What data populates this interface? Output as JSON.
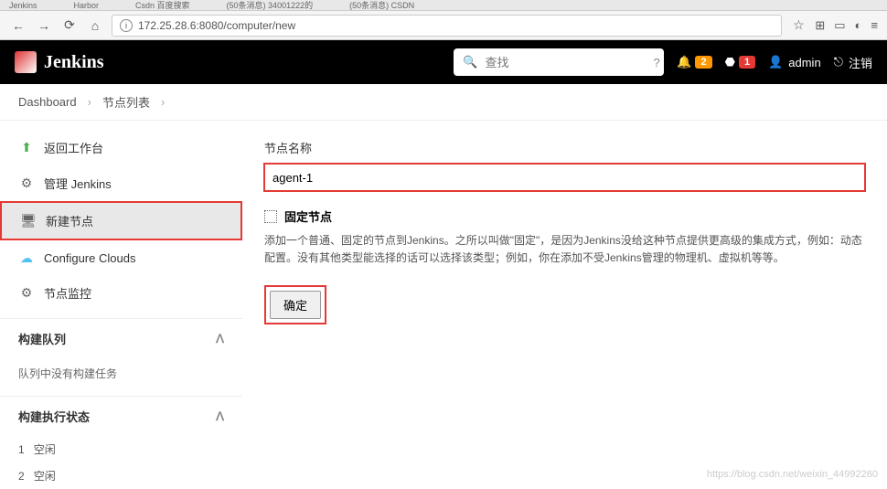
{
  "browser": {
    "tabs": [
      "Jenkins",
      "Harbor",
      "Csdn 百度搜索",
      "(50条消息) 34001222的",
      "(50条消息) CSDN"
    ],
    "url": "172.25.28.6:8080/computer/new"
  },
  "header": {
    "title": "Jenkins",
    "search_placeholder": "查找",
    "notif_count": "2",
    "alert_count": "1",
    "username": "admin",
    "logout_label": "注销"
  },
  "breadcrumbs": {
    "items": [
      "Dashboard",
      "节点列表"
    ]
  },
  "sidebar": {
    "links": [
      {
        "label": "返回工作台"
      },
      {
        "label": "管理 Jenkins"
      },
      {
        "label": "新建节点"
      },
      {
        "label": "Configure Clouds"
      },
      {
        "label": "节点监控"
      }
    ],
    "queue_title": "构建队列",
    "queue_empty": "队列中没有构建任务",
    "status_title": "构建执行状态",
    "executors": [
      {
        "num": "1",
        "state": "空闲"
      },
      {
        "num": "2",
        "state": "空闲"
      }
    ]
  },
  "form": {
    "name_label": "节点名称",
    "name_value": "agent-1",
    "fixed_label": "固定节点",
    "fixed_desc": "添加一个普通、固定的节点到Jenkins。之所以叫做\"固定\"，是因为Jenkins没给这种节点提供更高级的集成方式，例如：动态配置。没有其他类型能选择的话可以选择该类型；例如，你在添加不受Jenkins管理的物理机、虚拟机等等。",
    "ok_label": "确定"
  },
  "watermark": "https://blog.csdn.net/weixin_44992260"
}
